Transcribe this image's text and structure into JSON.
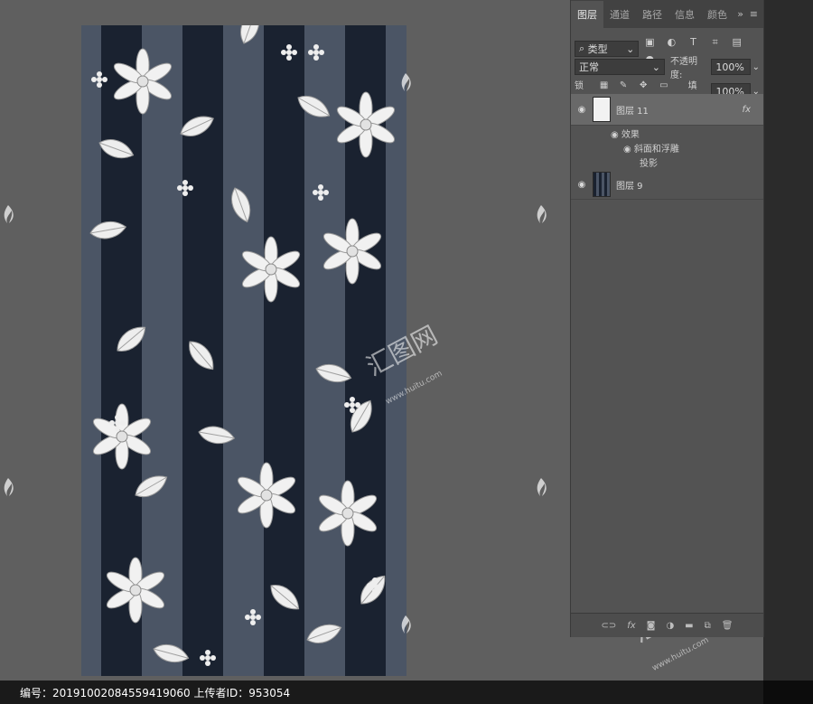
{
  "panel": {
    "tabs": [
      "图层",
      "通道",
      "路径",
      "信息",
      "颜色"
    ],
    "active_tab": "图层",
    "more": "»",
    "menu": "≡",
    "filter_select": "类型",
    "blend_mode": "正常",
    "opacity_label": "不透明度:",
    "opacity_value": "100%",
    "lock_label": "锁定:",
    "fill_label": "填充:",
    "fill_value": "100%",
    "layers": [
      {
        "name": "图层 11",
        "selected": true,
        "fx": "fx"
      },
      {
        "name": "图层 9",
        "selected": false
      }
    ],
    "effects_label": "效果",
    "effect_items": [
      "斜面和浮雕",
      "投影"
    ]
  },
  "caption": {
    "text": "编号：20191002084559419060 上传者ID：953054"
  },
  "watermark": {
    "text": "汇图网",
    "url": "www.huitu.com"
  },
  "colors": {
    "stripe_dark": "#1a2230",
    "stripe_light": "#4b5565",
    "workspace": "#5f5f5f"
  }
}
